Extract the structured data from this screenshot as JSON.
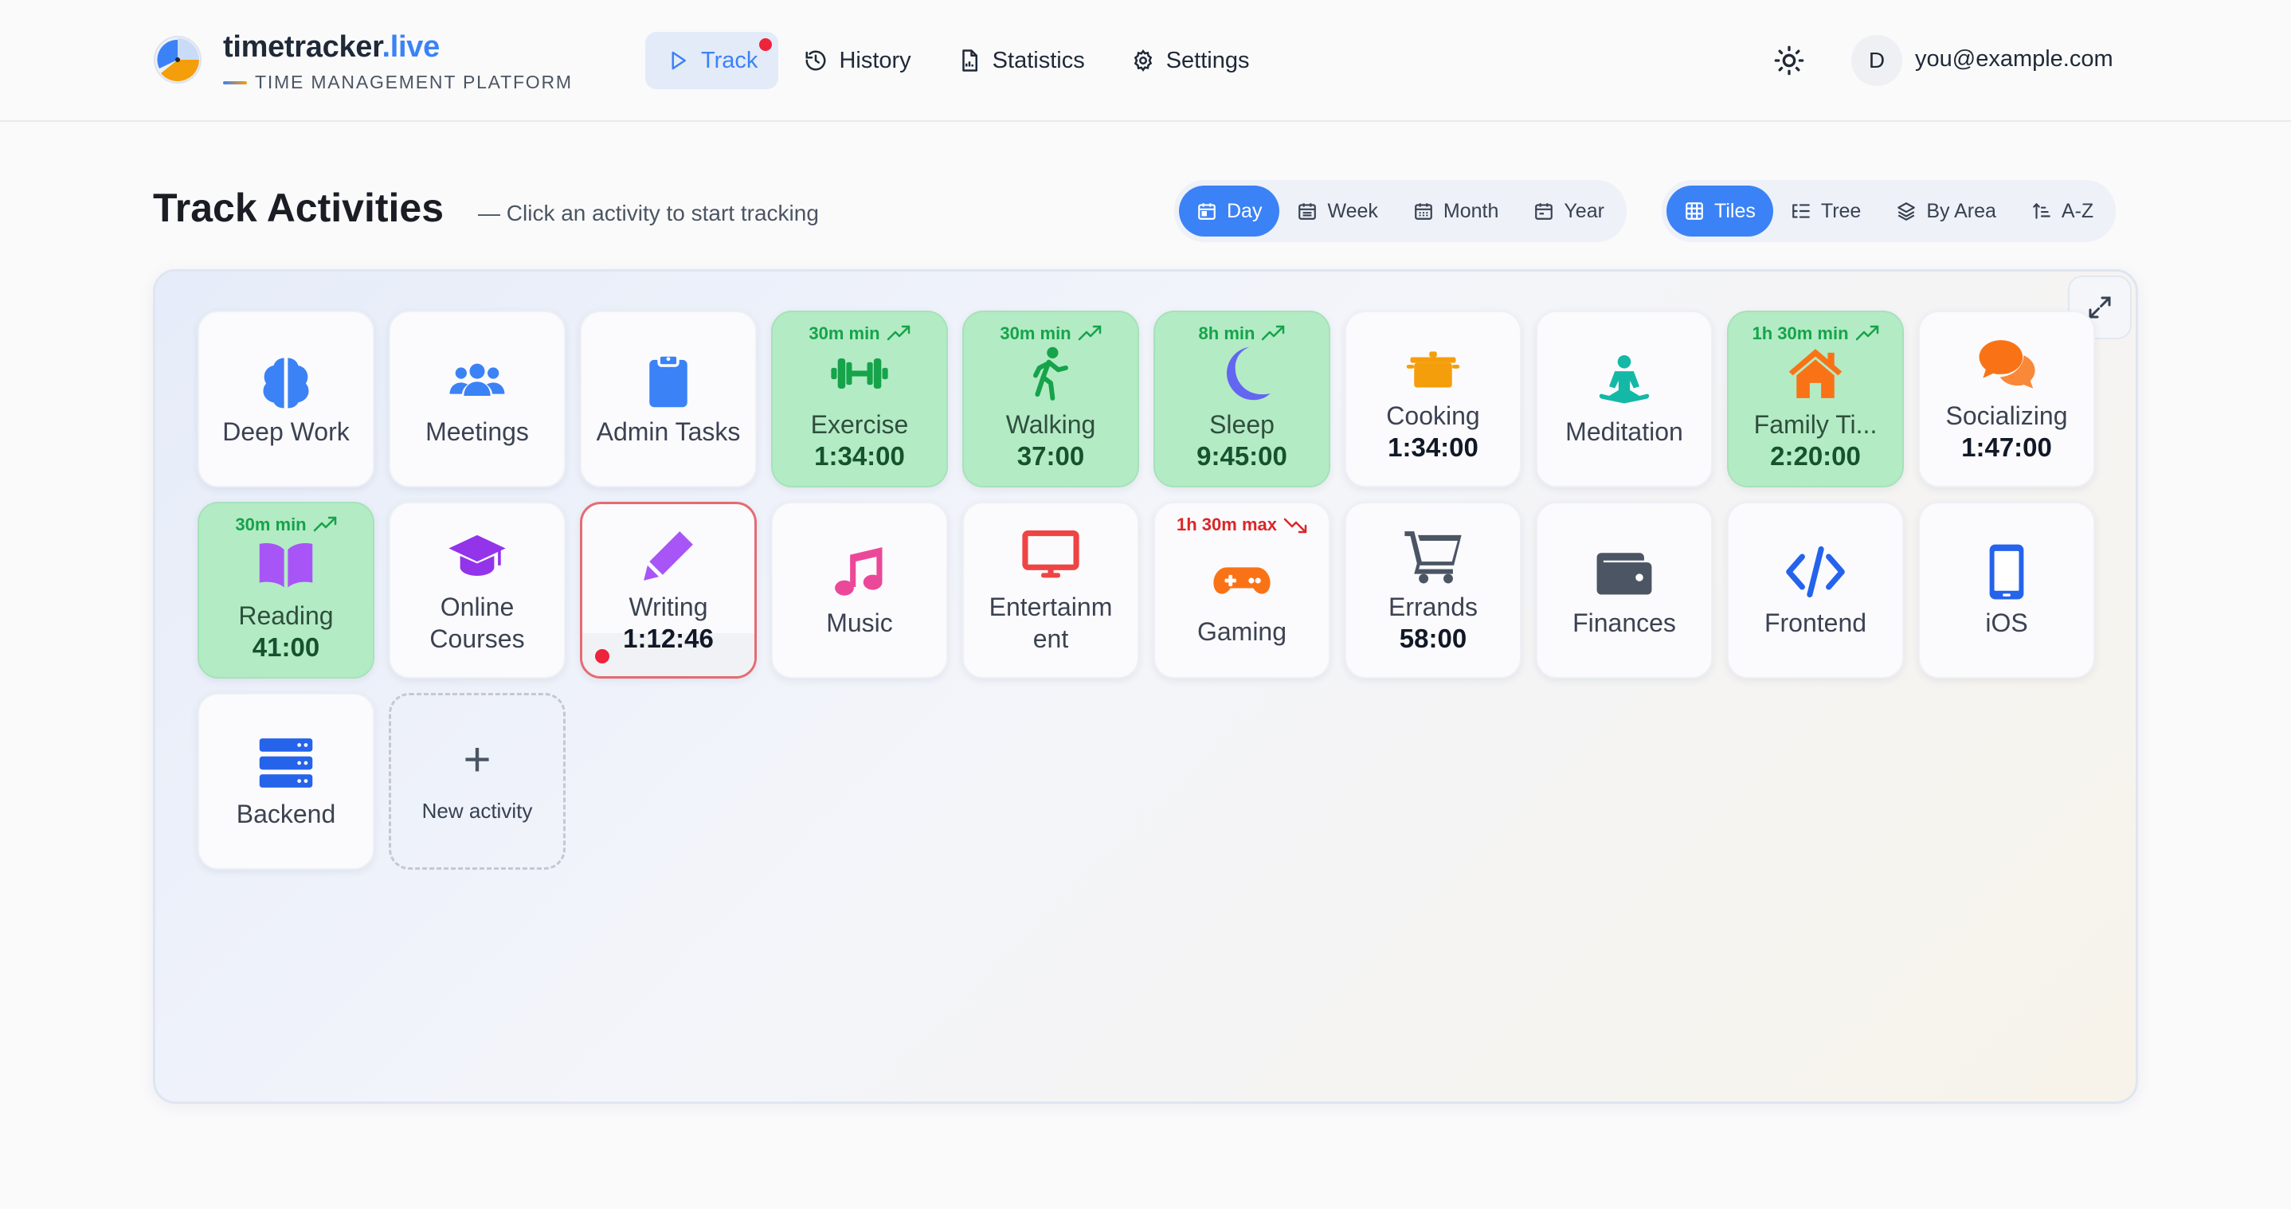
{
  "brand": {
    "name": "timetracker",
    "domain": ".live",
    "tagline": "TIME MANAGEMENT PLATFORM"
  },
  "nav": [
    {
      "label": "Track",
      "icon": "play-icon",
      "active": true
    },
    {
      "label": "History",
      "icon": "history-icon"
    },
    {
      "label": "Statistics",
      "icon": "report-icon"
    },
    {
      "label": "Settings",
      "icon": "gear-icon"
    }
  ],
  "user": {
    "initial": "D",
    "email": "you@example.com"
  },
  "page": {
    "title": "Track Activities",
    "subtitle": "— Click an activity to start tracking"
  },
  "period_filter": [
    {
      "label": "Day",
      "active": true
    },
    {
      "label": "Week"
    },
    {
      "label": "Month"
    },
    {
      "label": "Year"
    }
  ],
  "view_filter": [
    {
      "label": "Tiles",
      "active": true
    },
    {
      "label": "Tree"
    },
    {
      "label": "By Area"
    },
    {
      "label": "A-Z"
    }
  ],
  "activities": [
    {
      "name": "Deep Work",
      "icon": "brain-icon",
      "color": "#3b82f6"
    },
    {
      "name": "Meetings",
      "icon": "users-icon",
      "color": "#3b82f6"
    },
    {
      "name": "Admin Tasks",
      "icon": "clipboard-icon",
      "color": "#3b82f6"
    },
    {
      "name": "Exercise",
      "time": "1:34:00",
      "badge": "30m min",
      "badge_type": "min",
      "icon": "dumbbell-icon",
      "color": "#16a34a"
    },
    {
      "name": "Walking",
      "time": "37:00",
      "badge": "30m min",
      "badge_type": "min",
      "icon": "walking-icon",
      "color": "#16a34a"
    },
    {
      "name": "Sleep",
      "time": "9:45:00",
      "badge": "8h min",
      "badge_type": "min",
      "icon": "moon-icon",
      "color": "#6366f1"
    },
    {
      "name": "Cooking",
      "time": "1:34:00",
      "icon": "pot-icon",
      "color": "#f59e0b"
    },
    {
      "name": "Meditation",
      "icon": "meditation-icon",
      "color": "#14b8a6"
    },
    {
      "name": "Family Ti...",
      "time": "2:20:00",
      "badge": "1h 30m min",
      "badge_type": "min",
      "icon": "home-icon",
      "color": "#f97316"
    },
    {
      "name": "Socializing",
      "time": "1:47:00",
      "icon": "chat-icon",
      "color": "#f97316"
    },
    {
      "name": "Reading",
      "time": "41:00",
      "badge": "30m min",
      "badge_type": "min",
      "icon": "book-icon",
      "color": "#a855f7"
    },
    {
      "name": "Online Courses",
      "icon": "graduation-cap-icon",
      "color": "#9333ea"
    },
    {
      "name": "Writing",
      "time": "1:12:46",
      "tracking": true,
      "icon": "pencil-icon",
      "color": "#a855f7"
    },
    {
      "name": "Music",
      "icon": "music-icon",
      "color": "#ec4899"
    },
    {
      "name": "Entertainm ent",
      "icon": "monitor-icon",
      "color": "#ef4444"
    },
    {
      "name": "Gaming",
      "badge": "1h 30m max",
      "badge_type": "max",
      "icon": "gamepad-icon",
      "color": "#f97316"
    },
    {
      "name": "Errands",
      "time": "58:00",
      "icon": "cart-icon",
      "color": "#4b5563"
    },
    {
      "name": "Finances",
      "icon": "wallet-icon",
      "color": "#4b5563"
    },
    {
      "name": "Frontend",
      "icon": "code-icon",
      "color": "#2563eb"
    },
    {
      "name": "iOS",
      "icon": "mobile-icon",
      "color": "#2563eb"
    },
    {
      "name": "Backend",
      "icon": "server-icon",
      "color": "#2563eb"
    }
  ],
  "new_activity_label": "New activity"
}
